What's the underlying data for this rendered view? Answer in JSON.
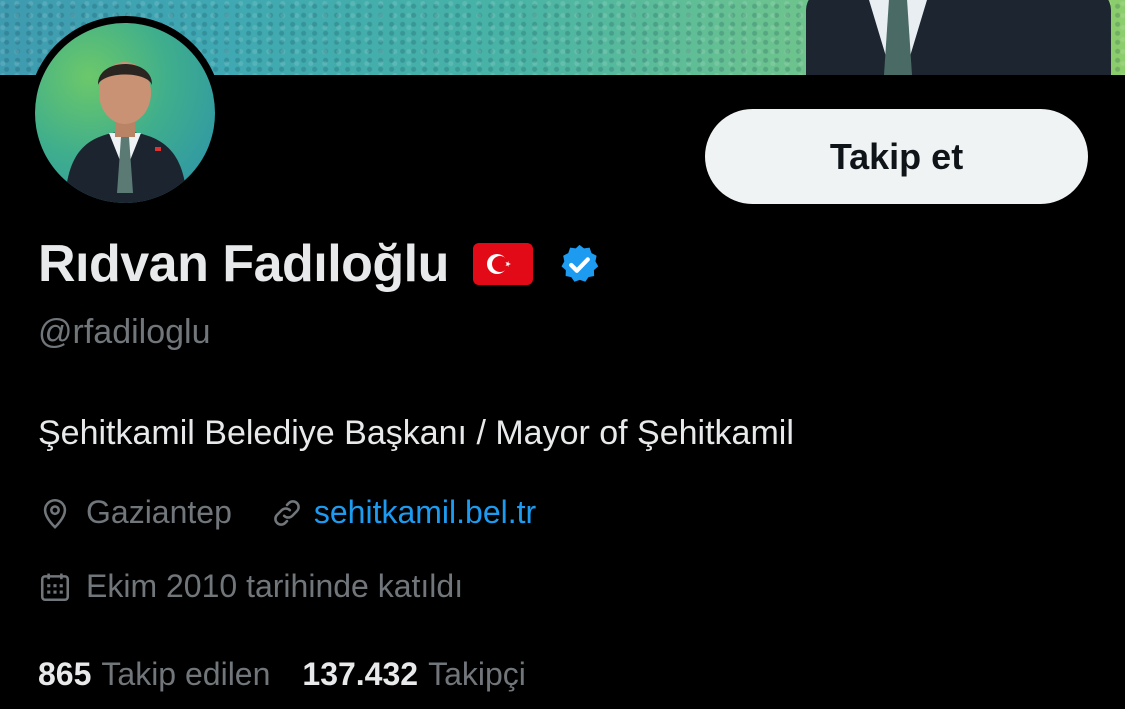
{
  "profile": {
    "name": "Rıdvan Fadıloğlu",
    "handle": "@rfadiloglu",
    "bio": "Şehitkamil Belediye Başkanı / Mayor of Şehitkamil",
    "location": "Gaziantep",
    "website": "sehitkamil.bel.tr",
    "joined": "Ekim 2010 tarihinde katıldı",
    "following_count": "865",
    "following_label": "Takip edilen",
    "followers_count": "137.432",
    "followers_label": "Takipçi",
    "flag_icon": "turkey-flag-icon",
    "verified_icon": "verified-badge-icon"
  },
  "actions": {
    "follow_label": "Takip et"
  },
  "colors": {
    "background": "#000000",
    "primary_text": "#e7e9ea",
    "secondary_text": "#71767b",
    "link": "#1d9bf0",
    "button_bg": "#eff3f4",
    "verified": "#1d9bf0"
  }
}
